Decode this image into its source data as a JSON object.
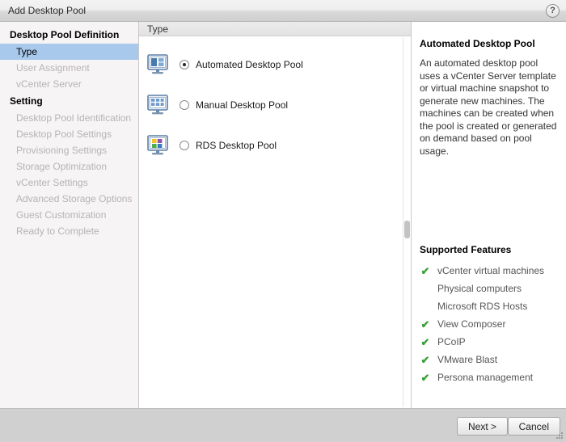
{
  "window": {
    "title": "Add Desktop Pool",
    "help_icon": "question-mark-icon",
    "help_label": "?"
  },
  "sidebar": {
    "groups": [
      {
        "label": "Desktop Pool Definition",
        "items": [
          {
            "label": "Type",
            "state": "active"
          },
          {
            "label": "User Assignment",
            "state": "disabled"
          },
          {
            "label": "vCenter Server",
            "state": "disabled"
          }
        ]
      },
      {
        "label": "Setting",
        "items": [
          {
            "label": "Desktop Pool Identification",
            "state": "disabled"
          },
          {
            "label": "Desktop Pool Settings",
            "state": "disabled"
          },
          {
            "label": "Provisioning Settings",
            "state": "disabled"
          },
          {
            "label": "Storage Optimization",
            "state": "disabled"
          },
          {
            "label": "vCenter Settings",
            "state": "disabled"
          },
          {
            "label": "Advanced Storage Options",
            "state": "disabled"
          },
          {
            "label": "Guest Customization",
            "state": "disabled"
          },
          {
            "label": "Ready to Complete",
            "state": "disabled"
          }
        ]
      }
    ]
  },
  "main": {
    "header": "Type",
    "options": [
      {
        "label": "Automated Desktop Pool",
        "selected": true,
        "icon": "monitor-automated-icon"
      },
      {
        "label": "Manual Desktop Pool",
        "selected": false,
        "icon": "monitor-grid-icon"
      },
      {
        "label": "RDS Desktop Pool",
        "selected": false,
        "icon": "monitor-color-tiles-icon"
      }
    ]
  },
  "details": {
    "title": "Automated Desktop Pool",
    "description": "An automated desktop pool uses a vCenter Server template or virtual machine snapshot to generate new machines. The machines can be created when the pool is created or generated on demand based on pool usage.",
    "features_title": "Supported Features",
    "features": [
      {
        "label": "vCenter virtual machines",
        "supported": true
      },
      {
        "label": "Physical computers",
        "supported": false
      },
      {
        "label": "Microsoft RDS Hosts",
        "supported": false
      },
      {
        "label": "View Composer",
        "supported": true
      },
      {
        "label": "PCoIP",
        "supported": true
      },
      {
        "label": "VMware Blast",
        "supported": true
      },
      {
        "label": "Persona management",
        "supported": true
      }
    ],
    "check_glyph": "✔"
  },
  "footer": {
    "next_label": "Next >",
    "cancel_label": "Cancel"
  },
  "colors": {
    "accent_selection": "#a8c8ec",
    "check_green": "#3aa03a",
    "sidebar_bg": "#f7f4f6",
    "footer_bg": "#d0d0d0"
  }
}
